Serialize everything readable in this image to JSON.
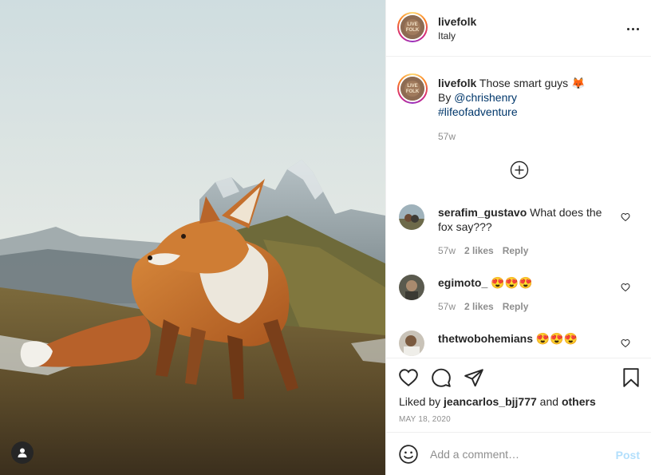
{
  "post": {
    "username": "livefolk",
    "location": "Italy",
    "avatar_text": "LIVE FOLK",
    "more_icon": "more-horizontal-icon"
  },
  "caption": {
    "username": "livefolk",
    "text": "Those smart guys",
    "emoji": "🦊",
    "by_prefix": "By ",
    "mention": "@chrishenry",
    "hashtag": "#lifeofadventure",
    "time": "57w"
  },
  "comments": [
    {
      "username": "serafim_gustavo",
      "text": "What does the fox say???",
      "time": "57w",
      "likes": "2 likes",
      "reply": "Reply"
    },
    {
      "username": "egimoto_",
      "text": "😍😍😍",
      "time": "57w",
      "likes": "2 likes",
      "reply": "Reply"
    },
    {
      "username": "thetwobohemians",
      "text": "😍😍😍"
    }
  ],
  "actions": {
    "liked_by_prefix": "Liked by ",
    "liked_by_user": "jeancarlos_bjj777",
    "and_text": " and ",
    "others": "others",
    "date": "MAY 18, 2020"
  },
  "add_comment": {
    "placeholder": "Add a comment…",
    "post_label": "Post"
  },
  "colors": {
    "link": "#00376b",
    "muted": "#8e8e8e",
    "post_disabled": "#b2dffc"
  }
}
